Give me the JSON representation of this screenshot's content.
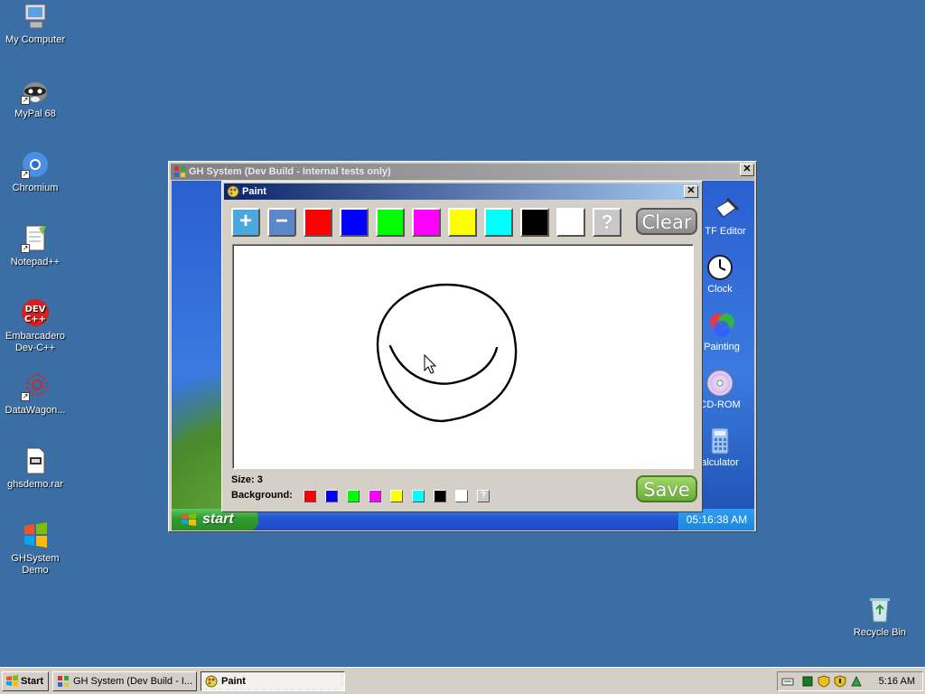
{
  "desktop": {
    "icons": [
      {
        "label": "My Computer"
      },
      {
        "label": "MyPal 68"
      },
      {
        "label": "Chromium"
      },
      {
        "label": "Notepad++"
      },
      {
        "label": "Embarcadero Dev-C++"
      },
      {
        "label": "DataWagon..."
      },
      {
        "label": "ghsdemo.rar"
      },
      {
        "label": "GHSystem Demo"
      },
      {
        "label": "Recycle Bin"
      }
    ]
  },
  "gh_window": {
    "title": "GH System (Dev Build - Internal tests only)",
    "close_glyph": "✕",
    "inner_taskbar": {
      "start_label": "start",
      "clock": "05:16:38 AM"
    },
    "right_icons": [
      {
        "label": "TF Editor",
        "icon": "rtf-editor-icon"
      },
      {
        "label": "Clock",
        "icon": "clock-icon"
      },
      {
        "label": "Painting",
        "icon": "painting-icon"
      },
      {
        "label": "CD-ROM",
        "icon": "cdrom-icon"
      },
      {
        "label": "alculator",
        "icon": "calculator-icon"
      }
    ]
  },
  "paint": {
    "title": "Paint",
    "close_glyph": "✕",
    "plus": "+",
    "minus": "−",
    "help": "?",
    "clear_label": "Clear",
    "save_label": "Save",
    "size_label": "Size: 3",
    "background_label": "Background:",
    "colors": [
      "#ff0000",
      "#0000ff",
      "#00ff00",
      "#ff00ff",
      "#ffff00",
      "#00ffff",
      "#000000",
      "#ffffff"
    ],
    "stroke_color": "#000000"
  },
  "taskbar": {
    "start_label": "Start",
    "tasks": [
      {
        "label": "GH System (Dev Build - I..."
      },
      {
        "label": "Paint"
      }
    ],
    "clock": "5:16 AM"
  }
}
